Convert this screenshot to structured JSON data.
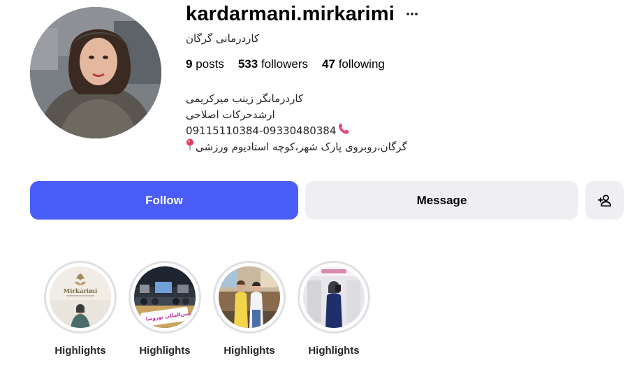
{
  "profile": {
    "username": "kardarmani.mirkarimi",
    "category": "کاردرمانی گرگان",
    "stats": {
      "posts_count": "9",
      "posts_label": "posts",
      "followers_count": "533",
      "followers_label": "followers",
      "following_count": "47",
      "following_label": "following"
    },
    "bio": {
      "line1": "کاردرمانگر زینب میرکریمی",
      "line2": "ارشدحرکات اصلاحی",
      "phone": "09115110384-09330480384",
      "address": "گرگان،روبروی پارک شهر،کوچه استادیوم ورزشی"
    }
  },
  "actions": {
    "follow_label": "Follow",
    "message_label": "Message",
    "suggest_icon": "add-person-icon"
  },
  "highlights": [
    {
      "label": "Highlights",
      "logo_text": "Mirkarimi"
    },
    {
      "label": "Highlights",
      "caption_text": "کنگره‌بین‌المللی نوروسا و ارتوز"
    },
    {
      "label": "Highlights"
    },
    {
      "label": "Highlights"
    }
  ],
  "icons": {
    "more": "more-horizontal-icon",
    "phone": "telephone-receiver-icon",
    "location": "round-pushpin-icon"
  },
  "colors": {
    "follow_button": "#4a5df9",
    "secondary_button": "#efeff3",
    "highlight_ring": "#dfe0e4"
  }
}
